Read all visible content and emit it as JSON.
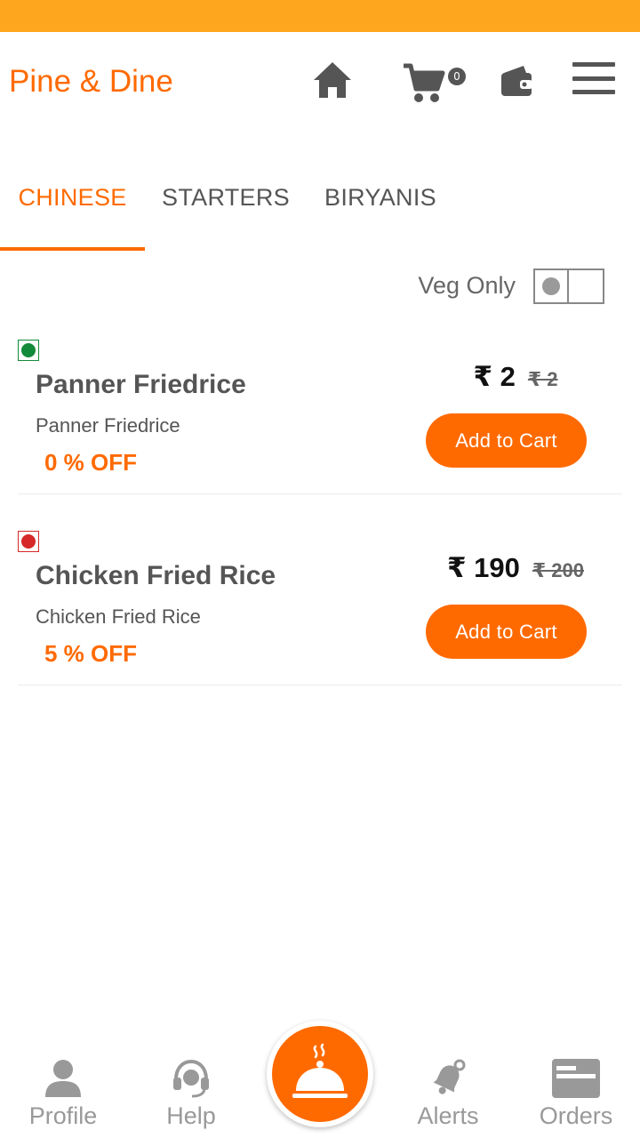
{
  "header": {
    "brand": "Pine & Dine",
    "cart_count": "0",
    "icons": [
      "home-icon",
      "cart-icon",
      "wallet-icon",
      "menu-icon"
    ]
  },
  "tabs": [
    {
      "label": "CHINESE",
      "active": true
    },
    {
      "label": "STARTERS",
      "active": false
    },
    {
      "label": "BIRYANIS",
      "active": false
    }
  ],
  "filter": {
    "veg_only_label": "Veg Only",
    "veg_only_on": false
  },
  "items": [
    {
      "type": "veg",
      "name": "Panner Friedrice",
      "description": "Panner Friedrice",
      "discount": "0 % OFF",
      "price": "₹ 2",
      "old_price": "₹ 2",
      "button_label": "Add to Cart"
    },
    {
      "type": "non-veg",
      "name": "Chicken Fried Rice",
      "description": "Chicken Fried Rice",
      "discount": "5 % OFF",
      "price": "₹ 190",
      "old_price": "₹ 200",
      "button_label": "Add to Cart"
    }
  ],
  "bottom_nav": {
    "profile": "Profile",
    "help": "Help",
    "alerts": "Alerts",
    "orders": "Orders",
    "center_icon": "food-cloche-icon"
  },
  "colors": {
    "accent": "#FF6A00",
    "status_bar": "#FFA61F",
    "veg": "#138a3a",
    "non_veg": "#d62828"
  }
}
